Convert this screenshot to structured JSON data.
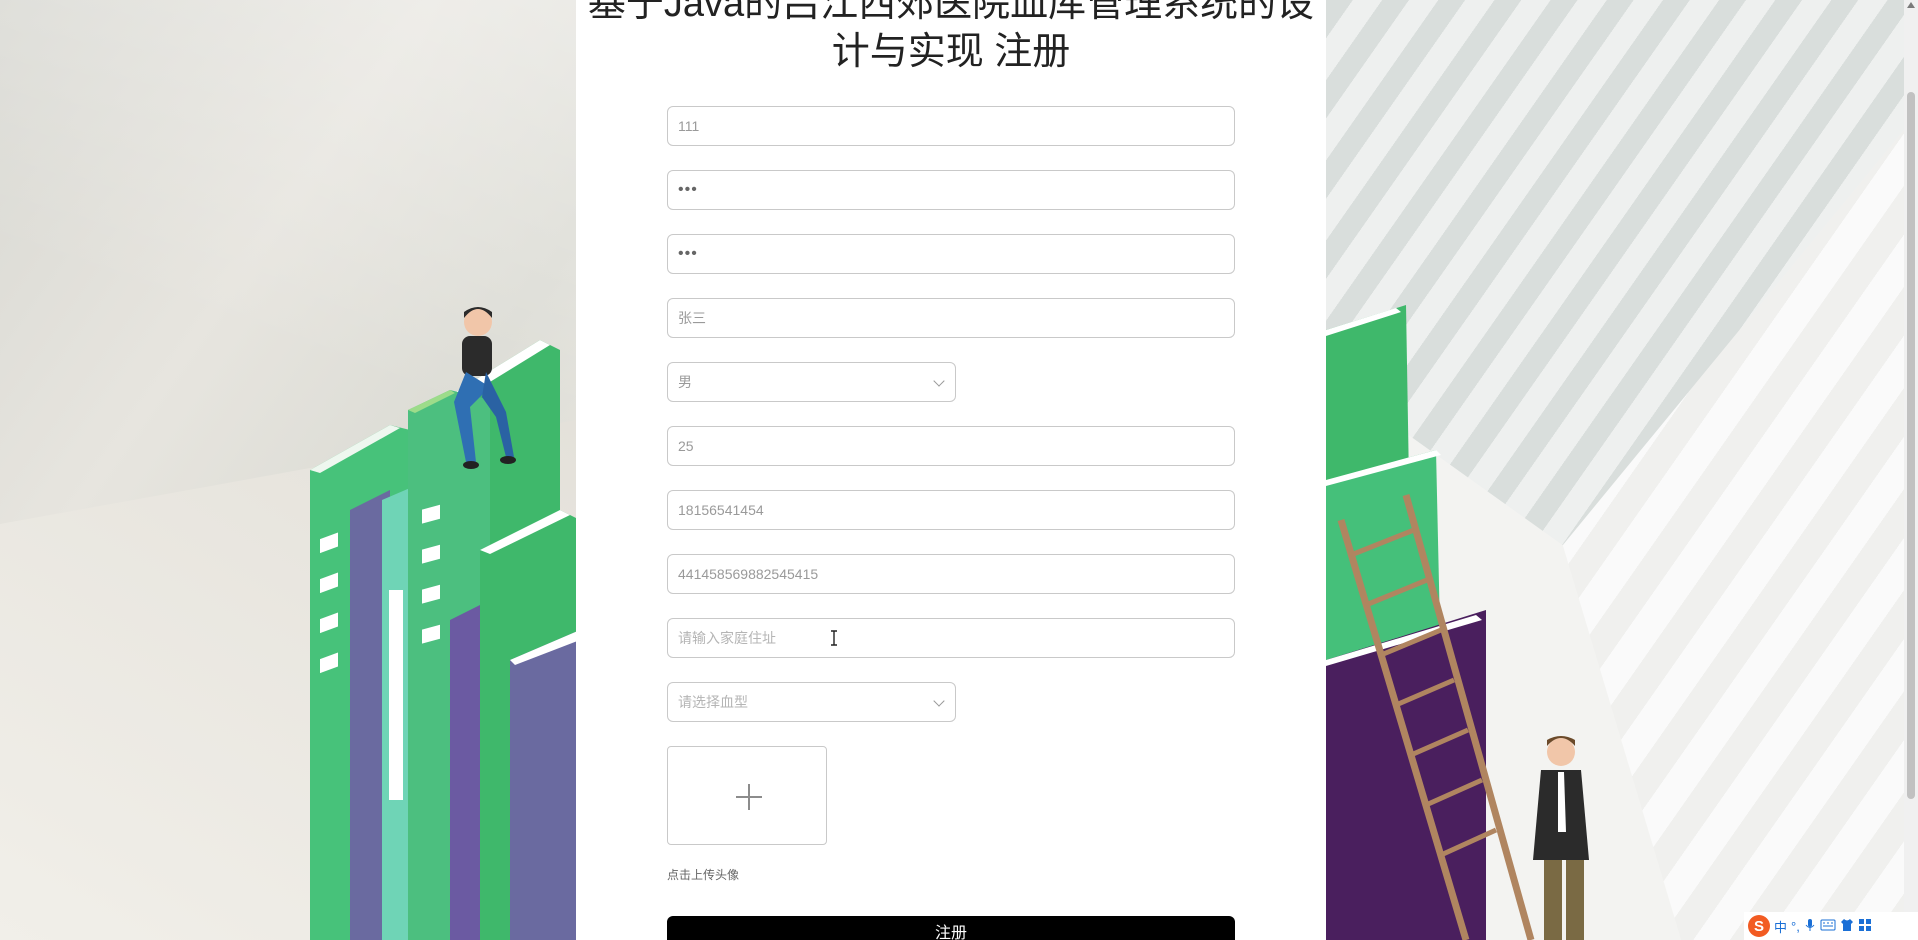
{
  "form": {
    "title": "基于Java的吕江西郊医院血库管理系统的设计与实现 注册",
    "username_value": "111",
    "password_value": "•••",
    "confirm_password_value": "•••",
    "name_value": "张三",
    "gender_value": "男",
    "age_value": "25",
    "phone_value": "18156541454",
    "id_card_value": "441458569882545415",
    "address_placeholder": "请输入家庭住址",
    "blood_type_placeholder": "请选择血型",
    "upload_hint": "点击上传头像",
    "submit_label": "注册"
  },
  "tray": {
    "ime_logo": "S",
    "ime_mode": "中",
    "ime_punct": "°,",
    "icons": [
      "microphone-icon",
      "keyboard-icon",
      "shirt-icon",
      "grid-icon"
    ]
  },
  "colors": {
    "panel_bg": "#ffffff",
    "submit_bg": "#000000",
    "input_border": "#c9c9c9",
    "book_green": "#3db56a",
    "book_purple": "#4a1f5e"
  }
}
